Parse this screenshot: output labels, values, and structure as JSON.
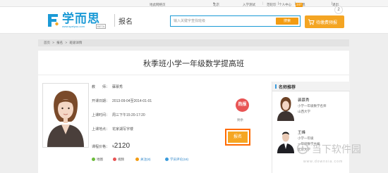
{
  "topbar": {
    "city": "地此网络页",
    "region": "北京",
    "test": "入学测试",
    "user": "范轮珍",
    "center": "个人中心",
    "message": "小消息",
    "count": "247",
    "exit": "退出"
  },
  "header": {
    "logo_text": "学而思",
    "logo_url": "www.speiyou.com",
    "logo_beta": "BETA",
    "page_tag": "报名",
    "search_placeholder": "输入关键字查找班级",
    "search_button": "搜索",
    "cart_label": "待缴费预报",
    "cart_count": "2"
  },
  "breadcrumb": [
    "首页",
    ">",
    "报名",
    ">",
    "班级详情"
  ],
  "course": {
    "title": "秋季班小学一年级数学提高班",
    "teacher_label": "教　　师：",
    "teacher": "蘇慕秀",
    "dates_label": "开课日期：",
    "dates": "2013-09-04至2014-01-01",
    "time_label": "上课时间：",
    "time": "周三下午15:20-17:20",
    "place_label": "上课地点：",
    "place": "花家湖写字楼",
    "price_label": "课程价格：",
    "currency": "¥",
    "price": "2120",
    "hot_badge": "热报",
    "remain": "剩余",
    "enroll": "报名"
  },
  "actions": {
    "map": "地图",
    "video": "视频",
    "follow": "关注(8)",
    "review": "学员评论(18)"
  },
  "sidebar": {
    "title": "名师推荐",
    "teachers": [
      {
        "name": "裴慕秀",
        "line1": "小学一年级数学名师",
        "line2": "山西大学"
      },
      {
        "name": "王峰",
        "line1": "小学一年级",
        "line2": "一年级数学主编",
        "line3": "北京大学"
      }
    ]
  },
  "watermark": {
    "text": "当下软件园",
    "url": "www.downxia.com"
  },
  "colors": {
    "brand_blue": "#1b9ad6",
    "accent_orange": "#f5a623",
    "hot_red": "#e85454"
  }
}
